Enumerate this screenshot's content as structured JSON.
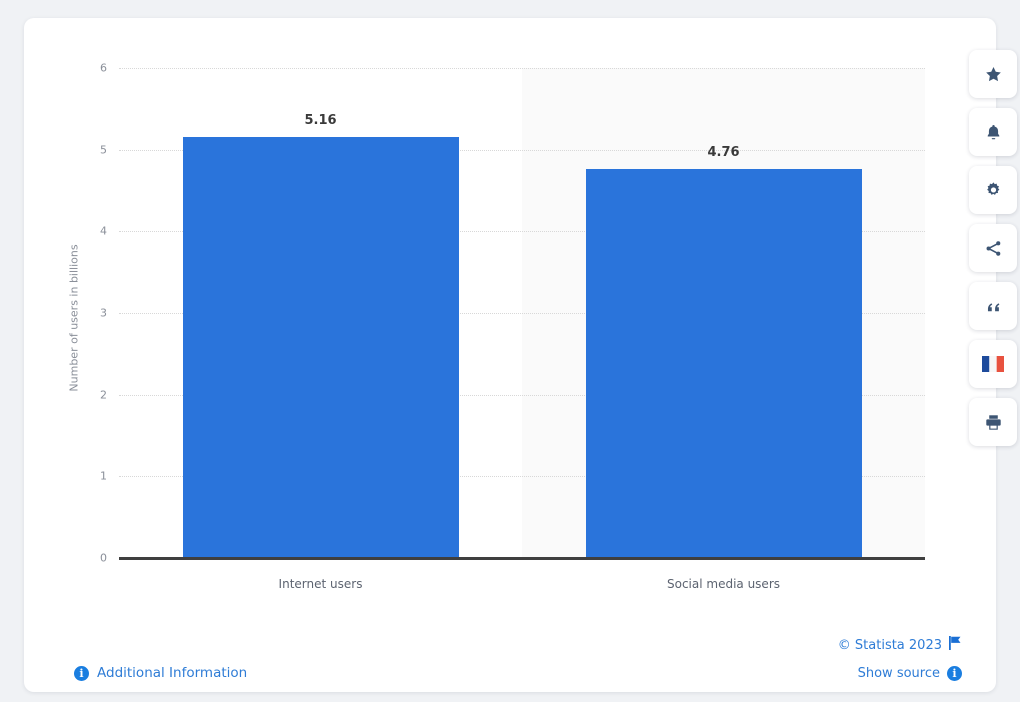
{
  "chart_data": {
    "type": "bar",
    "title": "",
    "xlabel": "",
    "ylabel": "Number of users in billions",
    "categories": [
      "Internet users",
      "Social media users"
    ],
    "values": [
      5.16,
      4.76
    ],
    "value_labels": [
      "5.16",
      "4.76"
    ],
    "ylim": [
      0,
      6
    ],
    "yticks": [
      0,
      1,
      2,
      3,
      4,
      5,
      6
    ],
    "ytick_labels": [
      "0",
      "1",
      "2",
      "3",
      "4",
      "5",
      "6"
    ],
    "grid": true,
    "legend": "none",
    "bar_color": "#2a74db"
  },
  "toolbar": {
    "items": [
      {
        "name": "favorite-icon",
        "label": "Add to favorites"
      },
      {
        "name": "notification-bell-icon",
        "label": "Notifications"
      },
      {
        "name": "settings-gear-icon",
        "label": "Settings"
      },
      {
        "name": "share-icon",
        "label": "Share"
      },
      {
        "name": "citation-quote-icon",
        "label": "Citation"
      },
      {
        "name": "french-flag-icon",
        "label": "French"
      },
      {
        "name": "print-icon",
        "label": "Print"
      }
    ]
  },
  "footer": {
    "additional_information": "Additional Information",
    "copyright": "© Statista 2023",
    "show_source": "Show source",
    "info_glyph": "i"
  },
  "colors": {
    "bar": "#2a74db",
    "link": "#2e7cd6",
    "info_badge": "#1a7ee0",
    "band": "#fafafa",
    "axis": "#3f3f3f",
    "page_background": "#f0f2f5",
    "icon": "#3d5573"
  }
}
